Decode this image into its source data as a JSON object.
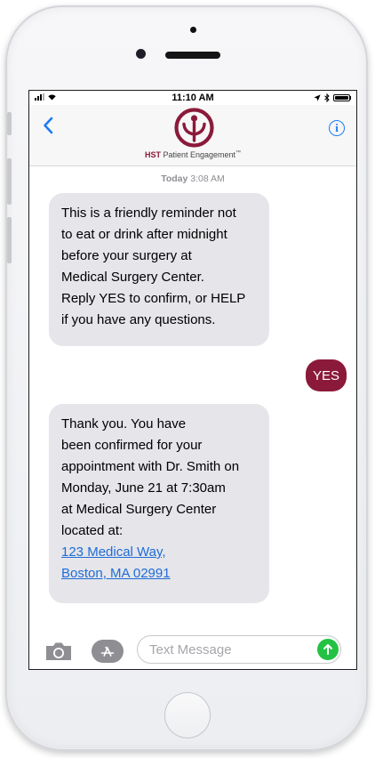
{
  "status_bar": {
    "time": "11:10 AM",
    "icons": [
      "cellular-signal-icon",
      "wifi-icon",
      "location-arrow-icon",
      "bluetooth-icon",
      "battery-icon"
    ]
  },
  "header": {
    "back_icon": "chevron-left-icon",
    "info_label": "i",
    "brand_bold": "HST",
    "brand_rest": "Patient Engagement",
    "brand_tm": "™",
    "logo_color": "#8b1a3a",
    "accent_color": "#1a7cf5"
  },
  "thread": {
    "timestamp_day": "Today",
    "timestamp_time": "3:08 AM",
    "incoming_1": {
      "lines": [
        "This is a friendly reminder not",
        "to eat or drink after midnight",
        "before your surgery at",
        "Medical Surgery Center.",
        "Reply YES to confirm, or HELP",
        "if you have any questions."
      ]
    },
    "outgoing_1": {
      "text": "YES",
      "color": "#8b1a3a"
    },
    "incoming_2": {
      "lines": [
        "Thank you. You have",
        "been confirmed for your",
        "appointment with Dr. Smith on",
        "Monday, June 21 at 7:30am",
        "at Medical Surgery Center",
        "located at:"
      ],
      "link_lines": [
        "123 Medical Way,",
        "Boston, MA 02991"
      ]
    }
  },
  "composer": {
    "placeholder": "Text Message",
    "value": "",
    "camera_icon": "camera-icon",
    "apps_icon": "app-store-icon",
    "send_icon": "send-arrow-up-icon",
    "send_color": "#23c244"
  }
}
